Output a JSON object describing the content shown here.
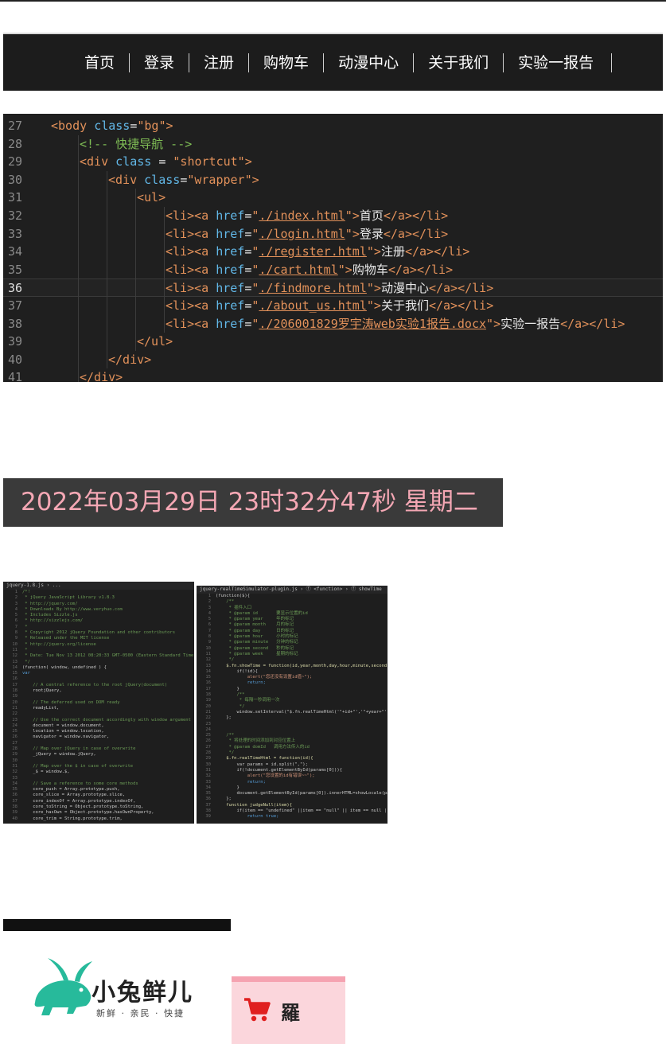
{
  "nav": {
    "items": [
      "首页",
      "登录",
      "注册",
      "购物车",
      "动漫中心",
      "关于我们",
      "实验一报告"
    ]
  },
  "code": {
    "lines": [
      {
        "n": "27",
        "parts": [
          [
            "t",
            "<"
          ],
          [
            "g",
            "body "
          ],
          [
            "a",
            "class"
          ],
          [
            "p",
            "="
          ],
          [
            "s",
            "\"bg\""
          ],
          [
            "g",
            ">"
          ]
        ]
      },
      {
        "n": "28",
        "indent": 1,
        "parts": [
          [
            "c",
            "<!-- 快捷导航 -->"
          ]
        ]
      },
      {
        "n": "29",
        "indent": 1,
        "parts": [
          [
            "g",
            "<div "
          ],
          [
            "a",
            "class"
          ],
          [
            "p",
            " = "
          ],
          [
            "s",
            "\"shortcut\""
          ],
          [
            "g",
            ">"
          ]
        ]
      },
      {
        "n": "30",
        "indent": 2,
        "parts": [
          [
            "g",
            "<div "
          ],
          [
            "a",
            "class"
          ],
          [
            "p",
            "="
          ],
          [
            "s",
            "\"wrapper\""
          ],
          [
            "g",
            ">"
          ]
        ]
      },
      {
        "n": "31",
        "indent": 3,
        "parts": [
          [
            "g",
            "<ul>"
          ]
        ]
      },
      {
        "n": "32",
        "indent": 4,
        "parts": [
          [
            "g",
            "<li><a "
          ],
          [
            "a",
            "href"
          ],
          [
            "p",
            "="
          ],
          [
            "s",
            "\""
          ],
          [
            "u",
            "./index.html"
          ],
          [
            "s",
            "\""
          ],
          [
            "g",
            ">"
          ],
          [
            "x",
            "首页"
          ],
          [
            "g",
            "</a></li>"
          ]
        ]
      },
      {
        "n": "33",
        "indent": 4,
        "parts": [
          [
            "g",
            "<li><a "
          ],
          [
            "a",
            "href"
          ],
          [
            "p",
            "="
          ],
          [
            "s",
            "\""
          ],
          [
            "u",
            "./login.html"
          ],
          [
            "s",
            "\""
          ],
          [
            "g",
            ">"
          ],
          [
            "x",
            "登录"
          ],
          [
            "g",
            "</a></li>"
          ]
        ]
      },
      {
        "n": "34",
        "indent": 4,
        "parts": [
          [
            "g",
            "<li><a "
          ],
          [
            "a",
            "href"
          ],
          [
            "p",
            "="
          ],
          [
            "s",
            "\""
          ],
          [
            "u",
            "./register.html"
          ],
          [
            "s",
            "\""
          ],
          [
            "g",
            ">"
          ],
          [
            "x",
            "注册"
          ],
          [
            "g",
            "</a></li>"
          ]
        ]
      },
      {
        "n": "35",
        "indent": 4,
        "parts": [
          [
            "g",
            "<li><a "
          ],
          [
            "a",
            "href"
          ],
          [
            "p",
            "="
          ],
          [
            "s",
            "\""
          ],
          [
            "u",
            "./cart.html"
          ],
          [
            "s",
            "\""
          ],
          [
            "g",
            ">"
          ],
          [
            "x",
            "购物车"
          ],
          [
            "g",
            "</a></li>"
          ]
        ]
      },
      {
        "n": "36",
        "indent": 4,
        "active": true,
        "parts": [
          [
            "g",
            "<li><a "
          ],
          [
            "a",
            "href"
          ],
          [
            "p",
            "="
          ],
          [
            "s",
            "\""
          ],
          [
            "u",
            "./findmore.html"
          ],
          [
            "s",
            "\""
          ],
          [
            "g",
            ">"
          ],
          [
            "x",
            "动漫中心"
          ],
          [
            "g",
            "</a></li>"
          ]
        ]
      },
      {
        "n": "37",
        "indent": 4,
        "parts": [
          [
            "g",
            "<li><a "
          ],
          [
            "a",
            "href"
          ],
          [
            "p",
            "="
          ],
          [
            "s",
            "\""
          ],
          [
            "u",
            "./about_us.html"
          ],
          [
            "s",
            "\""
          ],
          [
            "g",
            ">"
          ],
          [
            "x",
            "关于我们"
          ],
          [
            "g",
            "</a></li>"
          ]
        ]
      },
      {
        "n": "38",
        "indent": 4,
        "parts": [
          [
            "g",
            "<li><a "
          ],
          [
            "a",
            "href"
          ],
          [
            "p",
            "="
          ],
          [
            "s",
            "\""
          ],
          [
            "u",
            "./206001829罗宇涛web实验1报告.docx"
          ],
          [
            "s",
            "\""
          ],
          [
            "g",
            ">"
          ],
          [
            "x",
            "实验一报告"
          ],
          [
            "g",
            "</a></li>"
          ]
        ]
      },
      {
        "n": "39",
        "indent": 3,
        "parts": [
          [
            "g",
            "</ul>"
          ]
        ]
      },
      {
        "n": "40",
        "indent": 2,
        "parts": [
          [
            "g",
            "</div>"
          ]
        ]
      },
      {
        "n": "41",
        "indent": 1,
        "parts": [
          [
            "g",
            "</div>"
          ]
        ]
      }
    ]
  },
  "datetime": "2022年03月29日 23时32分47秒 星期二",
  "thumb_left": {
    "tab": "jquery-1.8.js ›  ...",
    "lines": [
      [
        "1",
        "/*!",
        "g"
      ],
      [
        "2",
        " * jQuery JavaScript Library v1.8.3",
        "g"
      ],
      [
        "3",
        " * http://jquery.com/",
        "g"
      ],
      [
        "4",
        " * Downloads By http://www.veryhuo.com",
        "g"
      ],
      [
        "5",
        " * Includes Sizzle.js",
        "g"
      ],
      [
        "6",
        " * http://sizzlejs.com/",
        "g"
      ],
      [
        "7",
        " *",
        "g"
      ],
      [
        "8",
        " * Copyright 2012 jQuery Foundation and other contributors",
        "g"
      ],
      [
        "9",
        " * Released under the MIT license",
        "g"
      ],
      [
        "10",
        " * http://jquery.org/license",
        "g"
      ],
      [
        "11",
        " *",
        "g"
      ],
      [
        "12",
        " * Date: Tue Nov 13 2012 08:20:33 GMT-0500 (Eastern Standard Time)",
        "g"
      ],
      [
        "13",
        " */",
        "g"
      ],
      [
        "14",
        "(function( window, undefined ) {",
        "w"
      ],
      [
        "15",
        "var",
        "b"
      ],
      [
        "16",
        "",
        "w"
      ],
      [
        "17",
        "    // A central reference to the root jQuery(document)",
        "g"
      ],
      [
        "18",
        "    rootjQuery,",
        "w"
      ],
      [
        "19",
        "",
        "w"
      ],
      [
        "20",
        "    // The deferred used on DOM ready",
        "g"
      ],
      [
        "21",
        "    readyList,",
        "w"
      ],
      [
        "22",
        "",
        "w"
      ],
      [
        "23",
        "    // Use the correct document accordingly with window argument (sandbox)",
        "g"
      ],
      [
        "24",
        "    document = window.document,",
        "w"
      ],
      [
        "25",
        "    location = window.location,",
        "w"
      ],
      [
        "26",
        "    navigator = window.navigator,",
        "w"
      ],
      [
        "27",
        "",
        "w"
      ],
      [
        "28",
        "    // Map over jQuery in case of overwrite",
        "g"
      ],
      [
        "29",
        "    _jQuery = window.jQuery,",
        "w"
      ],
      [
        "30",
        "",
        "w"
      ],
      [
        "31",
        "    // Map over the $ in case of overwrite",
        "g"
      ],
      [
        "32",
        "    _$ = window.$,",
        "w"
      ],
      [
        "33",
        "",
        "w"
      ],
      [
        "34",
        "    // Save a reference to some core methods",
        "g"
      ],
      [
        "35",
        "    core_push = Array.prototype.push,",
        "w"
      ],
      [
        "36",
        "    core_slice = Array.prototype.slice,",
        "w"
      ],
      [
        "37",
        "    core_indexOf = Array.prototype.indexOf,",
        "w"
      ],
      [
        "38",
        "    core_toString = Object.prototype.toString,",
        "w"
      ],
      [
        "39",
        "    core_hasOwn = Object.prototype.hasOwnProperty,",
        "w"
      ],
      [
        "40",
        "    core_trim = String.prototype.trim,",
        "w"
      ]
    ]
  },
  "thumb_right": {
    "tab": "jquery-realTimeSimulator-plugin.js ›  ⓕ <function> ›  ⓕ showTime",
    "lines": [
      [
        "1",
        "(function($){",
        "w"
      ],
      [
        "2",
        "    /**",
        "g"
      ],
      [
        "3",
        "     * 插件入口",
        "g"
      ],
      [
        "4",
        "     * @param id       要显示位置的id",
        "g"
      ],
      [
        "5",
        "     * @param year     年的标记",
        "g"
      ],
      [
        "6",
        "     * @param month    月的标记",
        "g"
      ],
      [
        "7",
        "     * @param day      日的标记",
        "g"
      ],
      [
        "8",
        "     * @param hour     小时的标记",
        "g"
      ],
      [
        "9",
        "     * @param minute   分钟的标记",
        "g"
      ],
      [
        "10",
        "     * @param second   秒的标记",
        "g"
      ],
      [
        "11",
        "     * @param week     星期的标记",
        "g"
      ],
      [
        "12",
        "     */",
        "g"
      ],
      [
        "13",
        "    $.fn.showTime = function(id,year,month,day,hour,minute,second,week){",
        "y"
      ],
      [
        "14",
        "        if(!id){",
        "w"
      ],
      [
        "15",
        "            alert(\"您还没有设置id值~\");",
        "o"
      ],
      [
        "16",
        "            return;",
        "b"
      ],
      [
        "17",
        "        }",
        "w"
      ],
      [
        "18",
        "        /**",
        "g"
      ],
      [
        "19",
        "         * 每隔一秒调用一次",
        "g"
      ],
      [
        "20",
        "         */",
        "g"
      ],
      [
        "21",
        "        window.setInterval(\"$.fn.realTimeHtml('\"+id+\"','\"+year+\"','\"+month+\"','\"+",
        "w"
      ],
      [
        "22",
        "    };",
        "w"
      ],
      [
        "23",
        "",
        "w"
      ],
      [
        "24",
        "",
        "w"
      ],
      [
        "25",
        "    /**",
        "g"
      ],
      [
        "26",
        "     * 将处理的时间添加到对应位置上",
        "g"
      ],
      [
        "27",
        "     * @param domId   调用方法传入的id",
        "g"
      ],
      [
        "28",
        "     */",
        "g"
      ],
      [
        "29",
        "    $.fn.realTimeHtml = function(id){",
        "y"
      ],
      [
        "30",
        "        var params = id.split(\",\");",
        "w"
      ],
      [
        "31",
        "        if(!document.getElementById(params[0])){",
        "w"
      ],
      [
        "32",
        "            alert(\"您设置的id有错误~~\");",
        "o"
      ],
      [
        "33",
        "            return;",
        "b"
      ],
      [
        "34",
        "        }",
        "w"
      ],
      [
        "35",
        "        document.getElementById(params[0]).innerHTML=showLocale(params);",
        "w"
      ],
      [
        "36",
        "    };",
        "w"
      ],
      [
        "37",
        "    function judgeNull(item){",
        "y"
      ],
      [
        "38",
        "        if(item == \"undefined\" ||item == \"null\" || item == null || item == undef",
        "w"
      ],
      [
        "39",
        "            return true;",
        "b"
      ]
    ]
  },
  "logo": {
    "name": "小兔鲜儿",
    "tagline": "新鲜 · 亲民 · 快捷",
    "brand_green": "#27ba9b"
  },
  "cart_badge": {
    "char": "羅",
    "icon": "shopping-cart-icon",
    "icon_color": "#e02020"
  }
}
